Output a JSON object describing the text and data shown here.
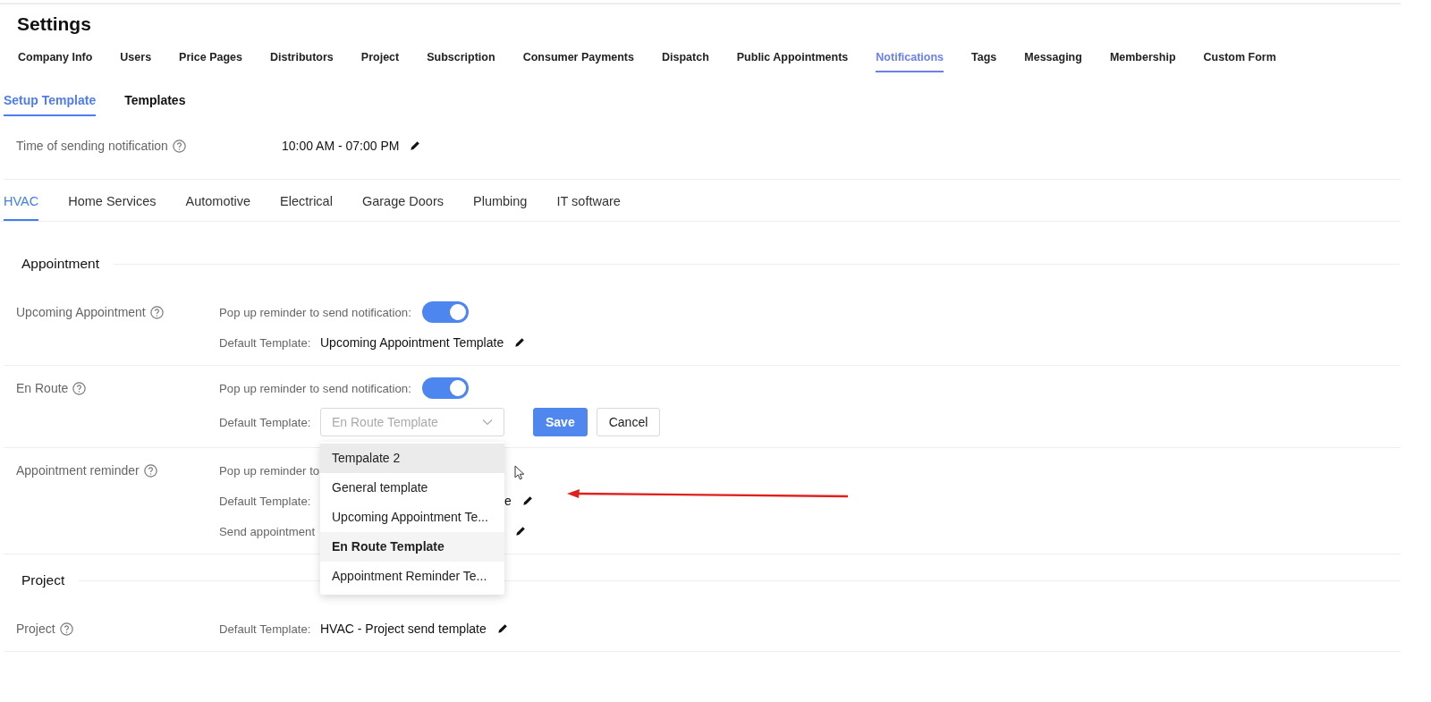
{
  "title": "Settings",
  "main_tabs": [
    {
      "label": "Company Info",
      "selected": false
    },
    {
      "label": "Users",
      "selected": false
    },
    {
      "label": "Price Pages",
      "selected": false
    },
    {
      "label": "Distributors",
      "selected": false
    },
    {
      "label": "Project",
      "selected": false
    },
    {
      "label": "Subscription",
      "selected": false
    },
    {
      "label": "Consumer Payments",
      "selected": false
    },
    {
      "label": "Dispatch",
      "selected": false
    },
    {
      "label": "Public Appointments",
      "selected": false
    },
    {
      "label": "Notifications",
      "selected": true
    },
    {
      "label": "Tags",
      "selected": false
    },
    {
      "label": "Messaging",
      "selected": false
    },
    {
      "label": "Membership",
      "selected": false
    },
    {
      "label": "Custom Form",
      "selected": false
    }
  ],
  "sub_tabs": [
    {
      "label": "Setup Template",
      "selected": true
    },
    {
      "label": "Templates",
      "selected": false
    }
  ],
  "sending_time": {
    "label": "Time of sending notification",
    "value": "10:00 AM - 07:00 PM"
  },
  "industry_tabs": [
    {
      "label": "HVAC",
      "selected": true
    },
    {
      "label": "Home Services",
      "selected": false
    },
    {
      "label": "Automotive",
      "selected": false
    },
    {
      "label": "Electrical",
      "selected": false
    },
    {
      "label": "Garage Doors",
      "selected": false
    },
    {
      "label": "Plumbing",
      "selected": false
    },
    {
      "label": "IT software",
      "selected": false
    }
  ],
  "sections": [
    {
      "title": "Appointment",
      "rows": [
        {
          "name": "Upcoming Appointment",
          "lines": [
            {
              "kind": "toggle",
              "label": "Pop up reminder to send notification:",
              "on": true
            },
            {
              "kind": "template",
              "label": "Default Template:",
              "value": "Upcoming Appointment Template"
            }
          ]
        },
        {
          "name": "En Route",
          "lines": [
            {
              "kind": "toggle",
              "label": "Pop up reminder to send notification:",
              "on": true
            },
            {
              "kind": "select",
              "label": "Default Template:",
              "placeholder": "En Route Template",
              "buttons": [
                "Save",
                "Cancel"
              ],
              "options": [
                {
                  "label": "Tempalate 2",
                  "selected": false,
                  "highlighted": true
                },
                {
                  "label": "General template",
                  "selected": false,
                  "highlighted": false
                },
                {
                  "label": "Upcoming Appointment Te...",
                  "selected": false,
                  "highlighted": false
                },
                {
                  "label": "En Route Template",
                  "selected": true,
                  "highlighted": false
                },
                {
                  "label": "Appointment Reminder Te...",
                  "selected": false,
                  "highlighted": false
                }
              ]
            }
          ]
        },
        {
          "name": "Appointment reminder",
          "lines": [
            {
              "kind": "covered",
              "label": "Pop up reminder to",
              "editable": false
            },
            {
              "kind": "covered",
              "label": "Default Template:",
              "value": "e",
              "editable": true
            },
            {
              "kind": "covered",
              "label": "Send appointment",
              "editable": true
            }
          ]
        }
      ]
    },
    {
      "title": "Project",
      "rows": [
        {
          "name": "Project",
          "lines": [
            {
              "kind": "template",
              "label": "Default Template:",
              "value": "HVAC - Project send template"
            }
          ]
        }
      ]
    }
  ]
}
